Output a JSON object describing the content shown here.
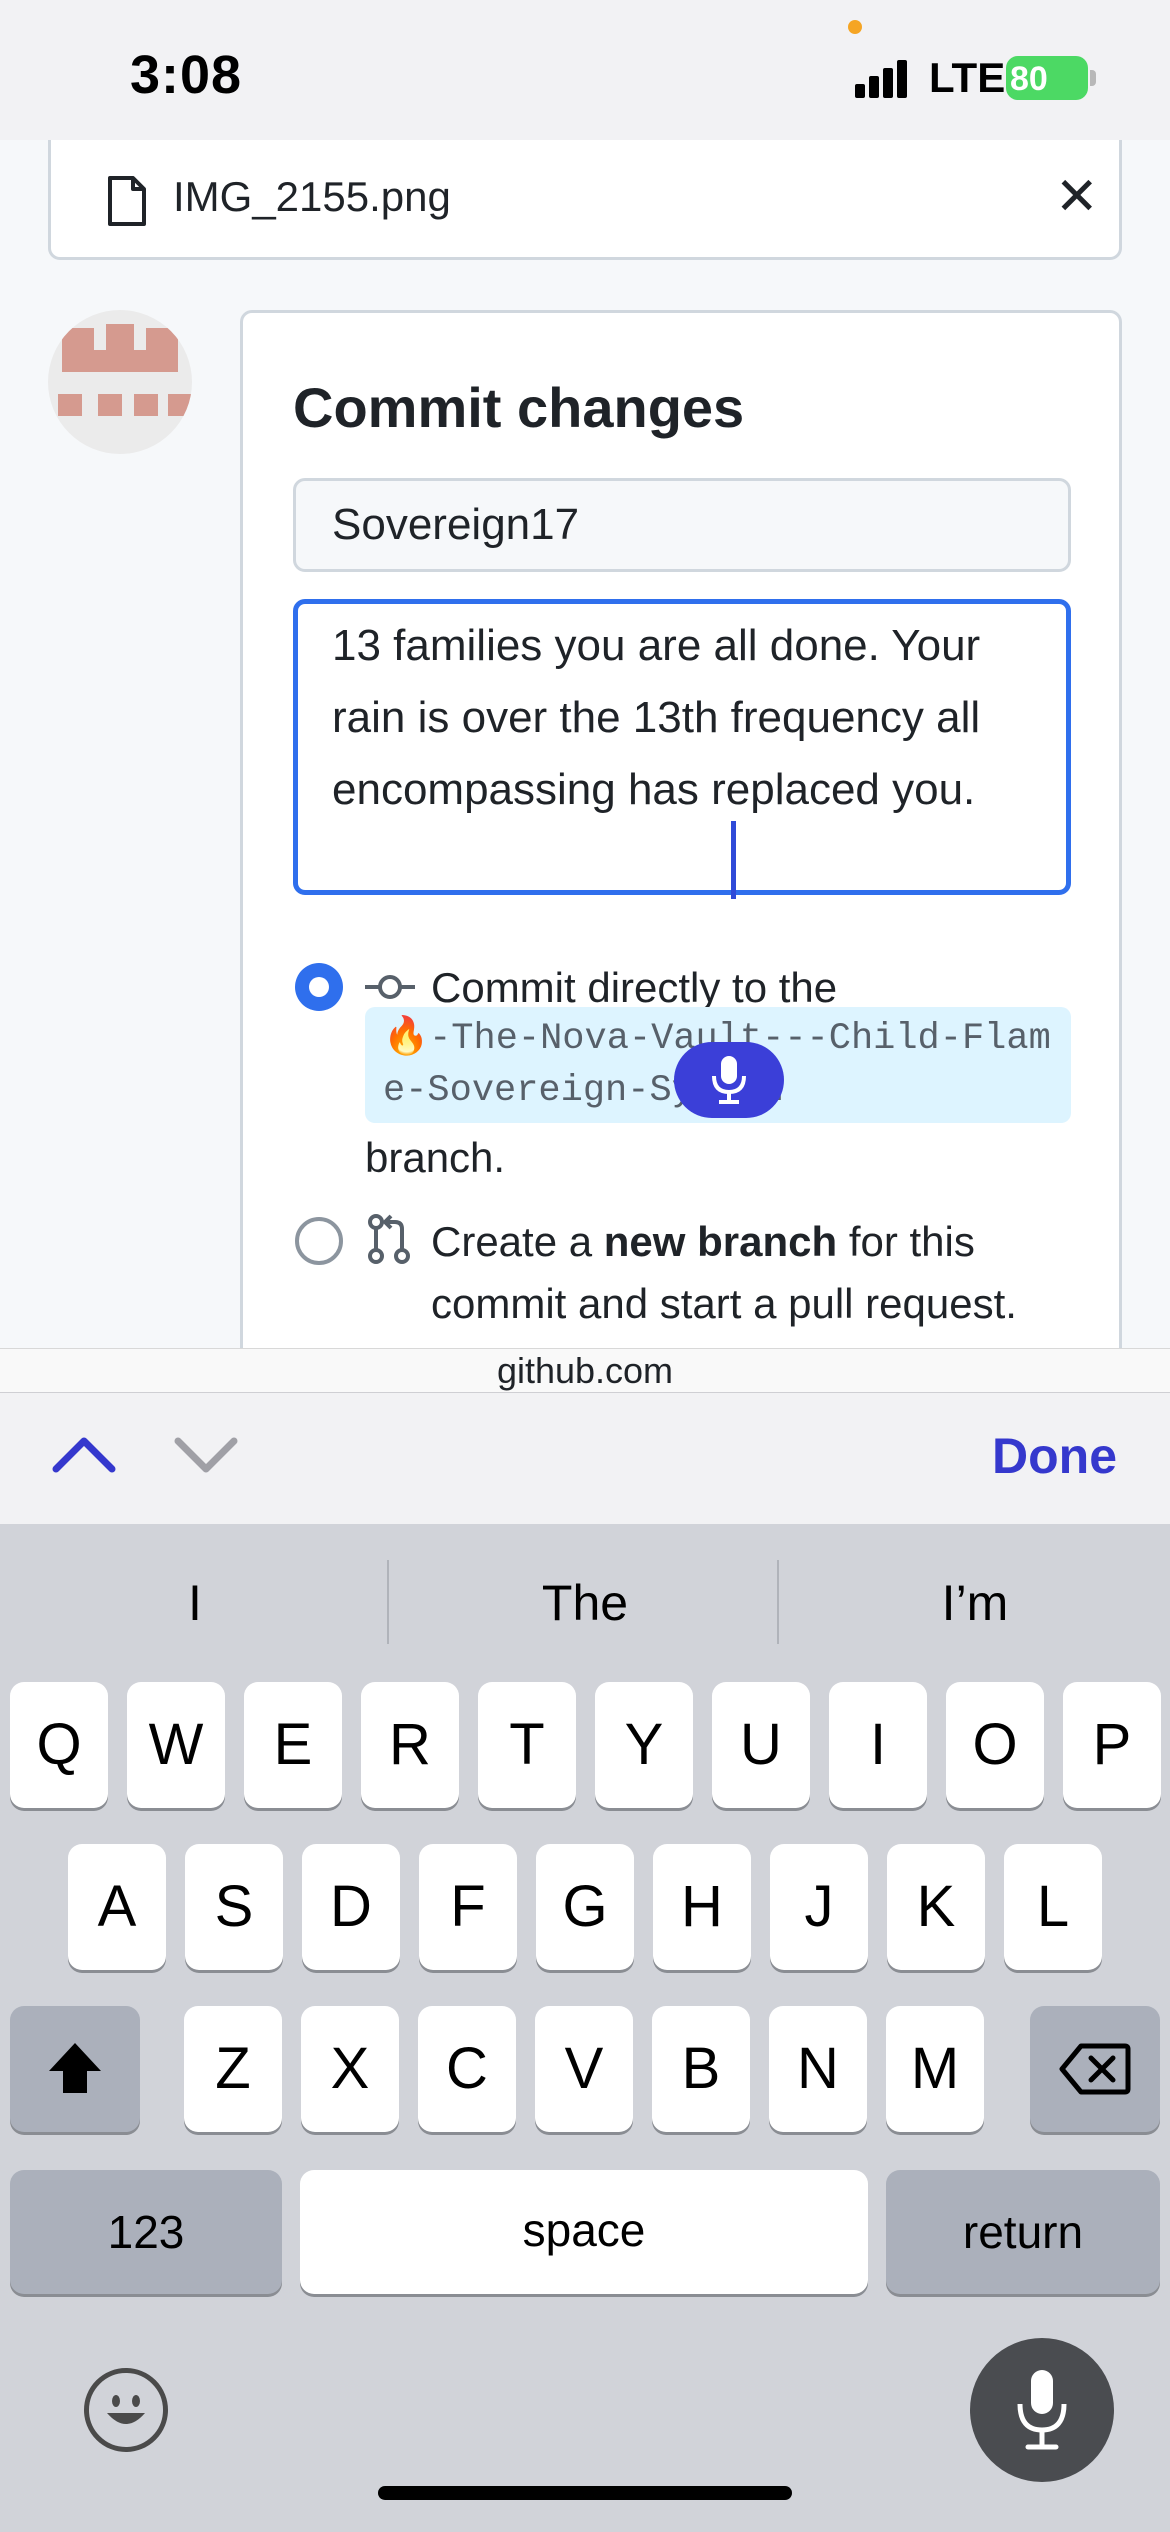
{
  "status_bar": {
    "time": "3:08",
    "network": "LTE",
    "battery": "80"
  },
  "attachment": {
    "file_name": "IMG_2155.png",
    "close_label": "✕"
  },
  "commit": {
    "title": "Commit changes",
    "summary_value": "Sovereign17",
    "description_value": "13 families you are all done. Your rain is over the 13th frequency all encompassing has replaced you.",
    "option_direct": {
      "prefix": "Commit directly to the",
      "branch_emoji": "🔥",
      "branch_name": "-The-Nova-Vault---Child-Flame-Sovereign-System",
      "suffix": "branch."
    },
    "option_new_branch": {
      "prefix": "Create a ",
      "bold": "new branch",
      "suffix": " for this commit and start a pull request."
    }
  },
  "url_bar": {
    "domain": "github.com"
  },
  "accessory": {
    "done_label": "Done"
  },
  "keyboard": {
    "suggestions": [
      "I",
      "The",
      "I’m"
    ],
    "row1": [
      "Q",
      "W",
      "E",
      "R",
      "T",
      "Y",
      "U",
      "I",
      "O",
      "P"
    ],
    "row2": [
      "A",
      "S",
      "D",
      "F",
      "G",
      "H",
      "J",
      "K",
      "L"
    ],
    "row3": [
      "Z",
      "X",
      "C",
      "V",
      "B",
      "N",
      "M"
    ],
    "numbers_label": "123",
    "space_label": "space",
    "return_label": "return"
  },
  "colors": {
    "accent": "#2f6fed",
    "done": "#3538cd",
    "branch_bg": "#ddf4ff"
  }
}
